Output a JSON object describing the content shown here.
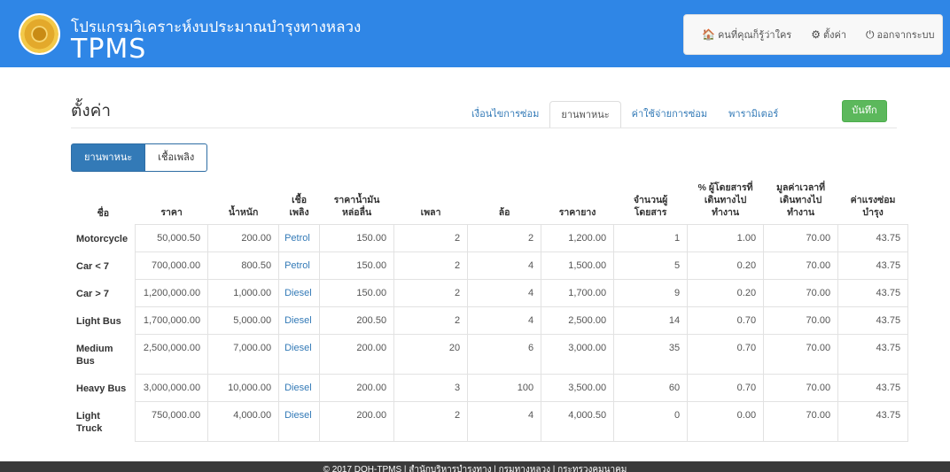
{
  "header": {
    "subtitle": "โปรแกรมวิเคราะห์งบประมาณบำรุงทางหลวง",
    "title": "TPMS",
    "logo_icon": "department-seal-icon"
  },
  "usermenu": {
    "items": [
      {
        "icon": "home-icon",
        "glyph": "🏠",
        "label": "คนที่คุณก็รู้ว่าใคร"
      },
      {
        "icon": "gear-icon",
        "glyph": "⚙",
        "label": "ตั้งค่า"
      },
      {
        "icon": "power-icon",
        "glyph": "⏻",
        "label": "ออกจากระบบ"
      }
    ]
  },
  "page": {
    "title": "ตั้งค่า",
    "save_label": "บันทึก"
  },
  "tabs": [
    {
      "label": "เงื่อนไขการซ่อม",
      "active": false
    },
    {
      "label": "ยานพาหนะ",
      "active": true
    },
    {
      "label": "ค่าใช้จ่ายการซ่อม",
      "active": false
    },
    {
      "label": "พารามิเตอร์",
      "active": false
    }
  ],
  "pills": [
    {
      "label": "ยานพาหนะ",
      "active": true
    },
    {
      "label": "เชื้อเพลิง",
      "active": false
    }
  ],
  "table": {
    "headers": [
      "ชื่อ",
      "ราคา",
      "น้ำหนัก",
      "เชื้อ\nเพลิง",
      "ราคาน้ำมัน\nหล่อลื่น",
      "เพลา",
      "ล้อ",
      "ราคายาง",
      "จำนวนผู้\nโดยสาร",
      "% ผู้โดยสารที่\nเดินทางไป\nทำงาน",
      "มูลค่าเวลาที่\nเดินทางไป\nทำงาน",
      "ค่าแรงซ่อม\nบำรุง"
    ],
    "rows": [
      [
        "Motorcycle",
        "50,000.50",
        "200.00",
        "Petrol",
        "150.00",
        "2",
        "2",
        "1,200.00",
        "1",
        "1.00",
        "70.00",
        "43.75"
      ],
      [
        "Car < 7",
        "700,000.00",
        "800.50",
        "Petrol",
        "150.00",
        "2",
        "4",
        "1,500.00",
        "5",
        "0.20",
        "70.00",
        "43.75"
      ],
      [
        "Car > 7",
        "1,200,000.00",
        "1,000.00",
        "Diesel",
        "150.00",
        "2",
        "4",
        "1,700.00",
        "9",
        "0.20",
        "70.00",
        "43.75"
      ],
      [
        "Light Bus",
        "1,700,000.00",
        "5,000.00",
        "Diesel",
        "200.50",
        "2",
        "4",
        "2,500.00",
        "14",
        "0.70",
        "70.00",
        "43.75"
      ],
      [
        "Medium Bus",
        "2,500,000.00",
        "7,000.00",
        "Diesel",
        "200.00",
        "20",
        "6",
        "3,000.00",
        "35",
        "0.70",
        "70.00",
        "43.75"
      ],
      [
        "Heavy Bus",
        "3,000,000.00",
        "10,000.00",
        "Diesel",
        "200.00",
        "3",
        "100",
        "3,500.00",
        "60",
        "0.70",
        "70.00",
        "43.75"
      ],
      [
        "Light Truck",
        "750,000.00",
        "4,000.00",
        "Diesel",
        "200.00",
        "2",
        "4",
        "4,000.50",
        "0",
        "0.00",
        "70.00",
        "43.75"
      ]
    ]
  },
  "footer": {
    "text": "© 2017 DOH-TPMS | สำนักบริหารบำรุงทาง | กรมทางหลวง | กระทรวงคมนาคม"
  }
}
